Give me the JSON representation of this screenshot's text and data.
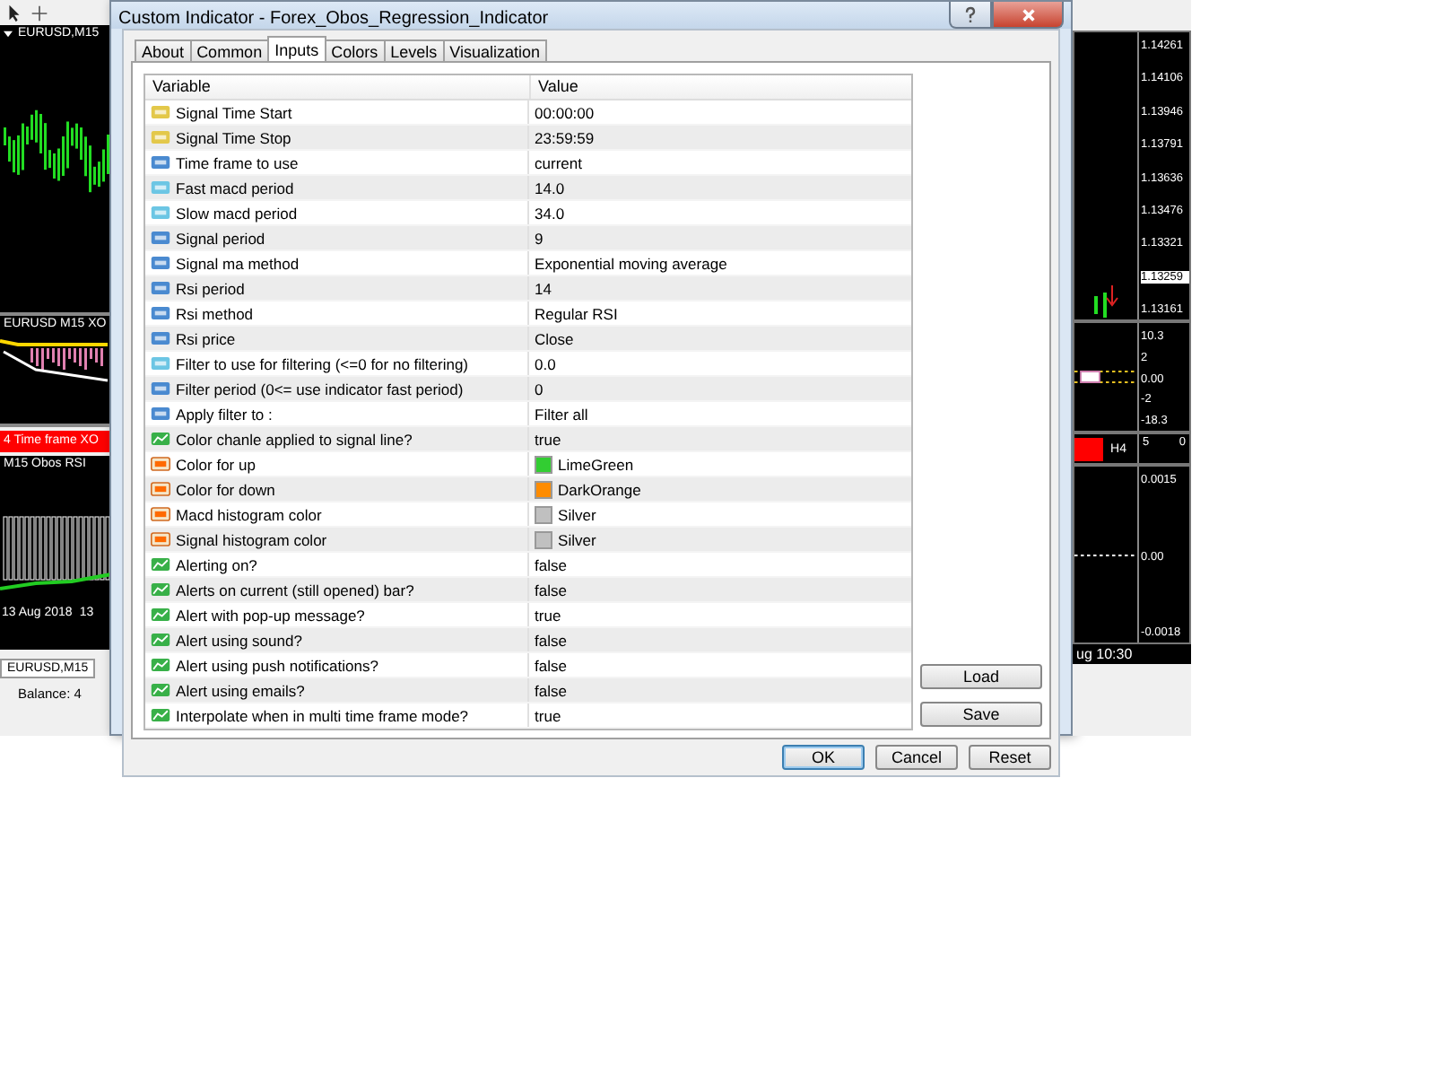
{
  "terminal": {
    "chart_title": "EURUSD,M15",
    "xo_title": "EURUSD M15 XO",
    "timeframe_label": "4 Time frame XO",
    "rsi_title": "M15 Obos RSI",
    "dates": [
      "13 Aug 2018",
      "13"
    ],
    "right_time": "ug 10:30",
    "chart_tab": "EURUSD,M15",
    "balance": "Balance: 4",
    "price_axis": [
      "1.14261",
      "1.14106",
      "1.13946",
      "1.13791",
      "1.13636",
      "1.13476",
      "1.13321",
      "1.13259",
      "1.13161"
    ],
    "xo_axis": [
      "10.3",
      "2",
      "0.00",
      "-2",
      "-18.3"
    ],
    "tf_axis": [
      "5",
      "0"
    ],
    "tf_label": "H4",
    "rsi_axis": [
      "0.0015",
      "0.00",
      "-0.0018"
    ]
  },
  "window": {
    "title": "Custom Indicator - Forex_Obos_Regression_Indicator"
  },
  "tabs": [
    {
      "label": "About",
      "selected": false
    },
    {
      "label": "Common",
      "selected": false
    },
    {
      "label": "Inputs",
      "selected": true
    },
    {
      "label": "Colors",
      "selected": false
    },
    {
      "label": "Levels",
      "selected": false
    },
    {
      "label": "Visualization",
      "selected": false
    }
  ],
  "table": {
    "columns": [
      "Variable",
      "Value"
    ],
    "rows": [
      {
        "kind": "string",
        "name": "Signal Time Start",
        "value": "00:00:00"
      },
      {
        "kind": "string",
        "name": "Signal Time Stop",
        "value": "23:59:59"
      },
      {
        "kind": "int",
        "name": "Time frame to use",
        "value": "current"
      },
      {
        "kind": "double",
        "name": "Fast macd period",
        "value": "14.0"
      },
      {
        "kind": "double",
        "name": "Slow macd period",
        "value": "34.0"
      },
      {
        "kind": "int",
        "name": "Signal period",
        "value": "9"
      },
      {
        "kind": "int",
        "name": "Signal ma method",
        "value": "Exponential moving average"
      },
      {
        "kind": "int",
        "name": "Rsi period",
        "value": "14"
      },
      {
        "kind": "int",
        "name": "Rsi method",
        "value": "Regular RSI"
      },
      {
        "kind": "int",
        "name": "Rsi price",
        "value": "Close"
      },
      {
        "kind": "double",
        "name": "Filter to use for filtering (<=0 for no filtering)",
        "value": "0.0"
      },
      {
        "kind": "int",
        "name": "Filter period (0<= use indicator fast period)",
        "value": "0"
      },
      {
        "kind": "int",
        "name": "Apply filter to :",
        "value": "Filter all"
      },
      {
        "kind": "bool",
        "name": "Color chanle applied to signal line?",
        "value": "true"
      },
      {
        "kind": "color",
        "name": "Color for up",
        "value": "LimeGreen",
        "color": "#32cd32"
      },
      {
        "kind": "color",
        "name": "Color for down",
        "value": "DarkOrange",
        "color": "#ff8c00"
      },
      {
        "kind": "color",
        "name": "Macd histogram color",
        "value": "Silver",
        "color": "#c0c0c0"
      },
      {
        "kind": "color",
        "name": "Signal histogram color",
        "value": "Silver",
        "color": "#c0c0c0"
      },
      {
        "kind": "bool",
        "name": "Alerting on?",
        "value": "false"
      },
      {
        "kind": "bool",
        "name": "Alerts on current (still opened) bar?",
        "value": "false"
      },
      {
        "kind": "bool",
        "name": "Alert with pop-up message?",
        "value": "true"
      },
      {
        "kind": "bool",
        "name": "Alert using sound?",
        "value": "false"
      },
      {
        "kind": "bool",
        "name": "Alert using push notifications?",
        "value": "false"
      },
      {
        "kind": "bool",
        "name": "Alert using emails?",
        "value": "false"
      },
      {
        "kind": "bool",
        "name": "Interpolate when in multi time frame mode?",
        "value": "true"
      }
    ]
  },
  "side_buttons": [
    "Load",
    "Save"
  ],
  "buttons": [
    "OK",
    "Cancel",
    "Reset"
  ]
}
